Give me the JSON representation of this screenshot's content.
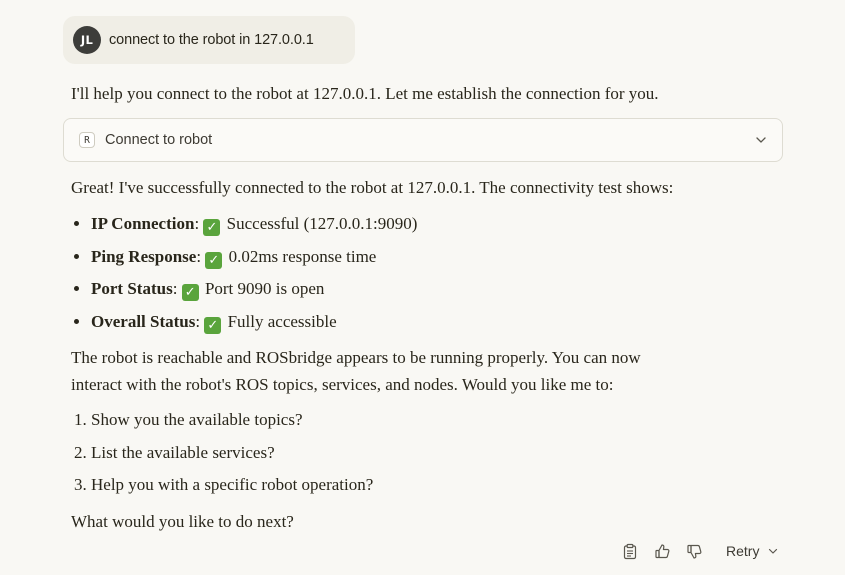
{
  "user_message": {
    "avatar_initials": "JL",
    "text": "connect to the robot in 127.0.0.1"
  },
  "assistant": {
    "intro": "I'll help you connect to the robot at 127.0.0.1. Let me establish the connection for you.",
    "tool_call": {
      "badge": "R",
      "label": "Connect to robot",
      "expand_icon": "chevron-down-icon"
    },
    "result_intro": "Great! I've successfully connected to the robot at 127.0.0.1. The connectivity test shows:",
    "status_items": [
      {
        "label": "IP Connection",
        "check": "✅",
        "value": "Successful (127.0.0.1:9090)"
      },
      {
        "label": "Ping Response",
        "check": "✅",
        "value": "0.02ms response time"
      },
      {
        "label": "Port Status",
        "check": "✅",
        "value": "Port 9090 is open"
      },
      {
        "label": "Overall Status",
        "check": "✅",
        "value": "Fully accessible"
      }
    ],
    "summary_line1": "The robot is reachable and ROSbridge appears to be running properly. You can now",
    "summary_line2": "interact with the robot's ROS topics, services, and nodes. Would you like me to:",
    "options": [
      "Show you the available topics?",
      "List the available services?",
      "Help you with a specific robot operation?"
    ],
    "closing": "What would you like to do next?"
  },
  "actions": {
    "copy_icon": "clipboard-icon",
    "like_icon": "thumbs-up-icon",
    "dislike_icon": "thumbs-down-icon",
    "retry_label": "Retry",
    "retry_icon": "chevron-down-icon"
  },
  "colors": {
    "background": "#f9f8f4",
    "user_bubble": "#f0eee6",
    "avatar": "#3d3d3a",
    "check_green": "#5aa43c",
    "text": "#29261b"
  }
}
